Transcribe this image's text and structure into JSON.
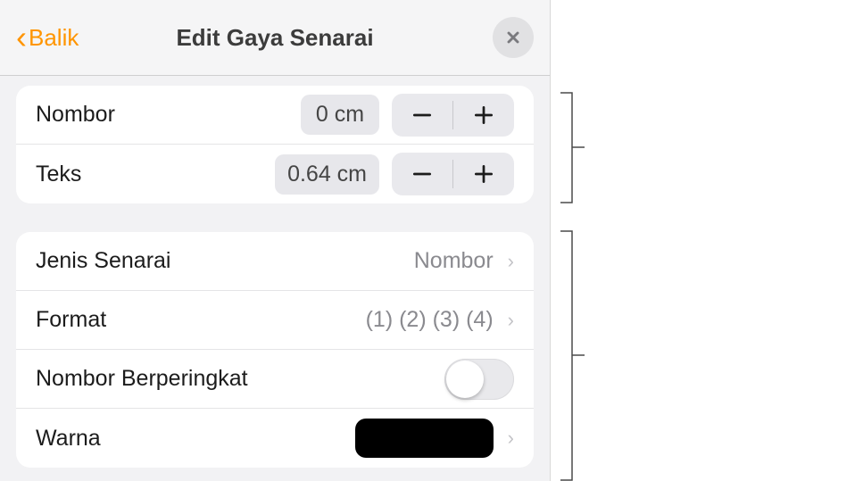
{
  "header": {
    "back_label": "Balik",
    "title": "Edit Gaya Senarai"
  },
  "indents": {
    "number": {
      "label": "Nombor",
      "value": "0 cm"
    },
    "text": {
      "label": "Teks",
      "value": "0.64 cm"
    }
  },
  "settings": {
    "list_type": {
      "label": "Jenis Senarai",
      "value": "Nombor"
    },
    "format": {
      "label": "Format",
      "value": "(1) (2) (3) (4)"
    },
    "tiered": {
      "label": "Nombor Berperingkat"
    },
    "color": {
      "label": "Warna",
      "value_hex": "#000000"
    }
  }
}
